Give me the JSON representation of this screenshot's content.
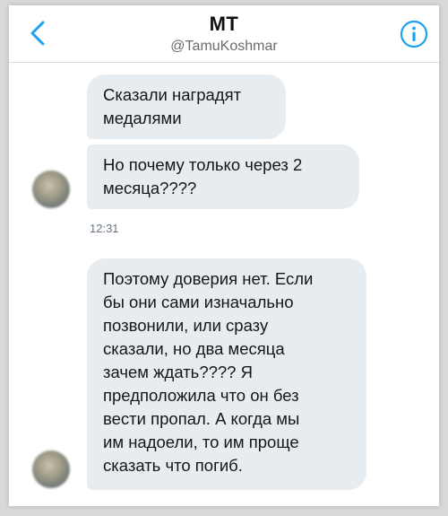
{
  "header": {
    "title": "MT",
    "handle": "@TamuKoshmar",
    "back_icon": "chevron-left-icon",
    "info_icon": "info-icon",
    "accent_color": "#1da1f2"
  },
  "messages": [
    {
      "text": "Сказали наградят\nмедалями"
    },
    {
      "text": "Но почему только через 2\nмесяца????"
    },
    {
      "text": "Поэтому доверия нет. Если\nбы они сами изначально\nпозвонили, или сразу\nсказали, но два месяца\nзачем ждать???? Я\nпредположила что он без\nвести пропал. А когда мы\nим надоели, то им проще\nсказать что погиб."
    }
  ],
  "timestamp": "12:31",
  "colors": {
    "bubble_bg": "#e6ecf0",
    "text": "#14171a",
    "muted": "#657786"
  }
}
